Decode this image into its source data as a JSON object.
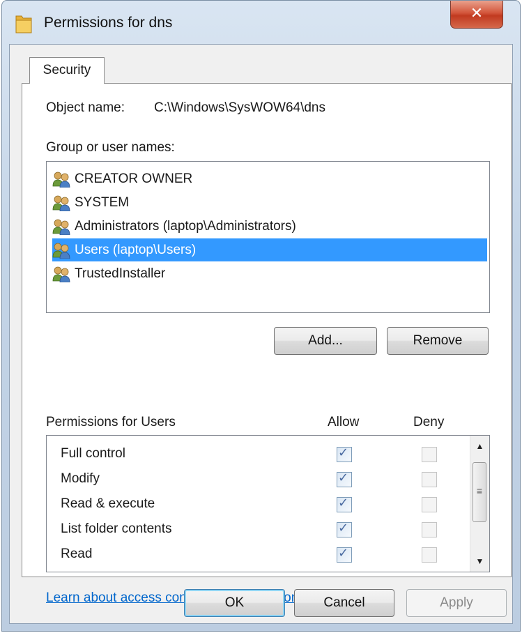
{
  "window": {
    "title": "Permissions for dns",
    "close_glyph": "✕",
    "icon": "folder-icon"
  },
  "tab": {
    "label": "Security"
  },
  "object": {
    "label": "Object name:",
    "value": "C:\\Windows\\SysWOW64\\dns"
  },
  "group_label": "Group or user names:",
  "users": [
    {
      "name": "CREATOR OWNER",
      "selected": false
    },
    {
      "name": "SYSTEM",
      "selected": false
    },
    {
      "name": "Administrators (laptop\\Administrators)",
      "selected": false
    },
    {
      "name": "Users (laptop\\Users)",
      "selected": true
    },
    {
      "name": "TrustedInstaller",
      "selected": false
    }
  ],
  "buttons": {
    "add": "Add...",
    "remove": "Remove",
    "ok": "OK",
    "cancel": "Cancel",
    "apply": "Apply"
  },
  "permissions": {
    "header": "Permissions for Users",
    "allow_label": "Allow",
    "deny_label": "Deny",
    "rows": [
      {
        "name": "Full control",
        "allow": true,
        "deny": false
      },
      {
        "name": "Modify",
        "allow": true,
        "deny": false
      },
      {
        "name": "Read & execute",
        "allow": true,
        "deny": false
      },
      {
        "name": "List folder contents",
        "allow": true,
        "deny": false
      },
      {
        "name": "Read",
        "allow": true,
        "deny": false
      }
    ]
  },
  "link": "Learn about access control and permissions",
  "colors": {
    "selection": "#3399ff",
    "link": "#0066cc",
    "close": "#c13a20"
  }
}
